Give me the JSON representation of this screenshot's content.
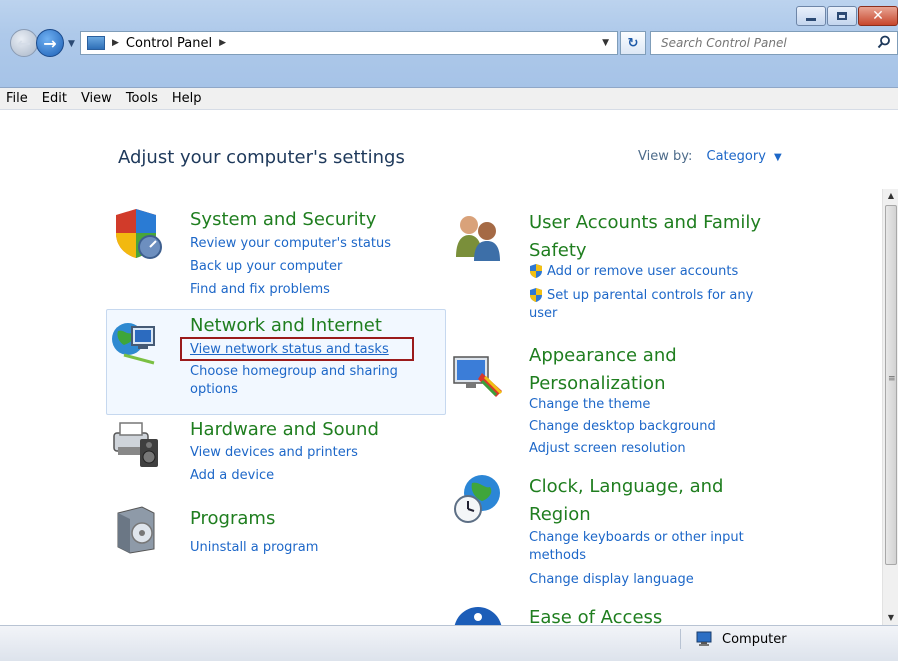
{
  "window": {
    "minimize_label": "–",
    "maximize_label": "□",
    "close_label": "✕"
  },
  "address": {
    "path_item": "Control Panel",
    "search_placeholder": "Search Control Panel"
  },
  "menu": {
    "items": [
      "File",
      "Edit",
      "View",
      "Tools",
      "Help"
    ]
  },
  "main": {
    "heading": "Adjust your computer's settings",
    "view_by_label": "View by:",
    "view_by_value": "Category",
    "categories": [
      {
        "title": "System and Security",
        "icon": "shield-icon",
        "links": [
          "Review your computer's status",
          "Back up your computer",
          "Find and fix problems"
        ]
      },
      {
        "title": "Network and Internet",
        "icon": "network-globe-icon",
        "links": [
          "View network status and tasks",
          "Choose homegroup and sharing options"
        ]
      },
      {
        "title": "Hardware and Sound",
        "icon": "printer-speaker-icon",
        "links": [
          "View devices and printers",
          "Add a device"
        ]
      },
      {
        "title": "Programs",
        "icon": "programs-box-icon",
        "links": [
          "Uninstall a program"
        ]
      },
      {
        "title": "User Accounts and Family Safety",
        "icon": "users-icon",
        "links": [
          "Add or remove user accounts",
          "Set up parental controls for any user"
        ]
      },
      {
        "title": "Appearance and Personalization",
        "icon": "monitor-palette-icon",
        "links": [
          "Change the theme",
          "Change desktop background",
          "Adjust screen resolution"
        ]
      },
      {
        "title": "Clock, Language, and Region",
        "icon": "clock-globe-icon",
        "links": [
          "Change keyboards or other input methods",
          "Change display language"
        ]
      },
      {
        "title": "Ease of Access",
        "icon": "ease-of-access-icon",
        "links": []
      }
    ]
  },
  "status": {
    "location": "Computer"
  },
  "colors": {
    "category_title": "#1f7e1f",
    "link": "#1d67c8",
    "highlight_border": "#9b1b1b"
  }
}
